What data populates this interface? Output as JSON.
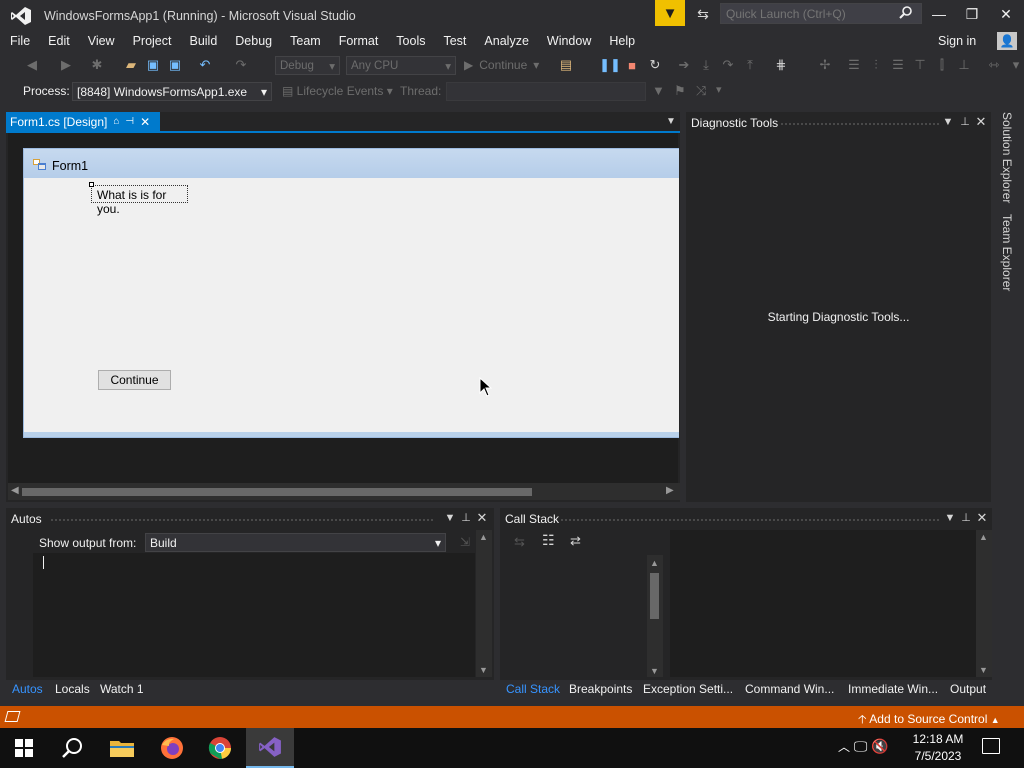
{
  "window": {
    "title": "WindowsFormsApp1 (Running) - Microsoft Visual Studio",
    "quick_launch_placeholder": "Quick Launch (Ctrl+Q)",
    "controls": {
      "minimize": "—",
      "maximize": "❐",
      "close": "✕"
    }
  },
  "menu": [
    "File",
    "Edit",
    "View",
    "Project",
    "Build",
    "Debug",
    "Team",
    "Format",
    "Tools",
    "Test",
    "Analyze",
    "Window",
    "Help"
  ],
  "account": {
    "signin": "Sign in"
  },
  "toolbar": {
    "config": "Debug",
    "platform": "Any CPU",
    "continue_label": "Continue"
  },
  "debug_location": {
    "process_label": "Process:",
    "process_value": "[8848] WindowsFormsApp1.exe",
    "lifecycle_label": "Lifecycle Events",
    "thread_label": "Thread:"
  },
  "document": {
    "tab_label": "Form1.cs [Design]",
    "form": {
      "title": "Form1",
      "label_text": "What is is for you.",
      "button_text": "Continue"
    }
  },
  "diagnostic": {
    "title": "Diagnostic Tools",
    "message": "Starting Diagnostic Tools..."
  },
  "side_tabs": [
    "Solution Explorer",
    "Team Explorer"
  ],
  "autos": {
    "title": "Autos",
    "show_output_label": "Show output from:",
    "output_source": "Build",
    "tabs": [
      "Autos",
      "Locals",
      "Watch 1"
    ],
    "active_tab": "Autos"
  },
  "callstack": {
    "title": "Call Stack",
    "tabs": [
      "Call Stack",
      "Breakpoints",
      "Exception Setti...",
      "Command Win...",
      "Immediate Win...",
      "Output"
    ],
    "active_tab": "Call Stack"
  },
  "status": {
    "source_control": "Add to Source Control",
    "color": "#ca5100"
  },
  "taskbar": {
    "apps": [
      "start-icon",
      "search-icon",
      "file-explorer-icon",
      "firefox-icon",
      "chrome-icon",
      "visual-studio-icon"
    ],
    "time": "12:18 AM",
    "date": "7/5/2023"
  },
  "colors": {
    "accent": "#007acc",
    "filter": "#f0c000"
  }
}
